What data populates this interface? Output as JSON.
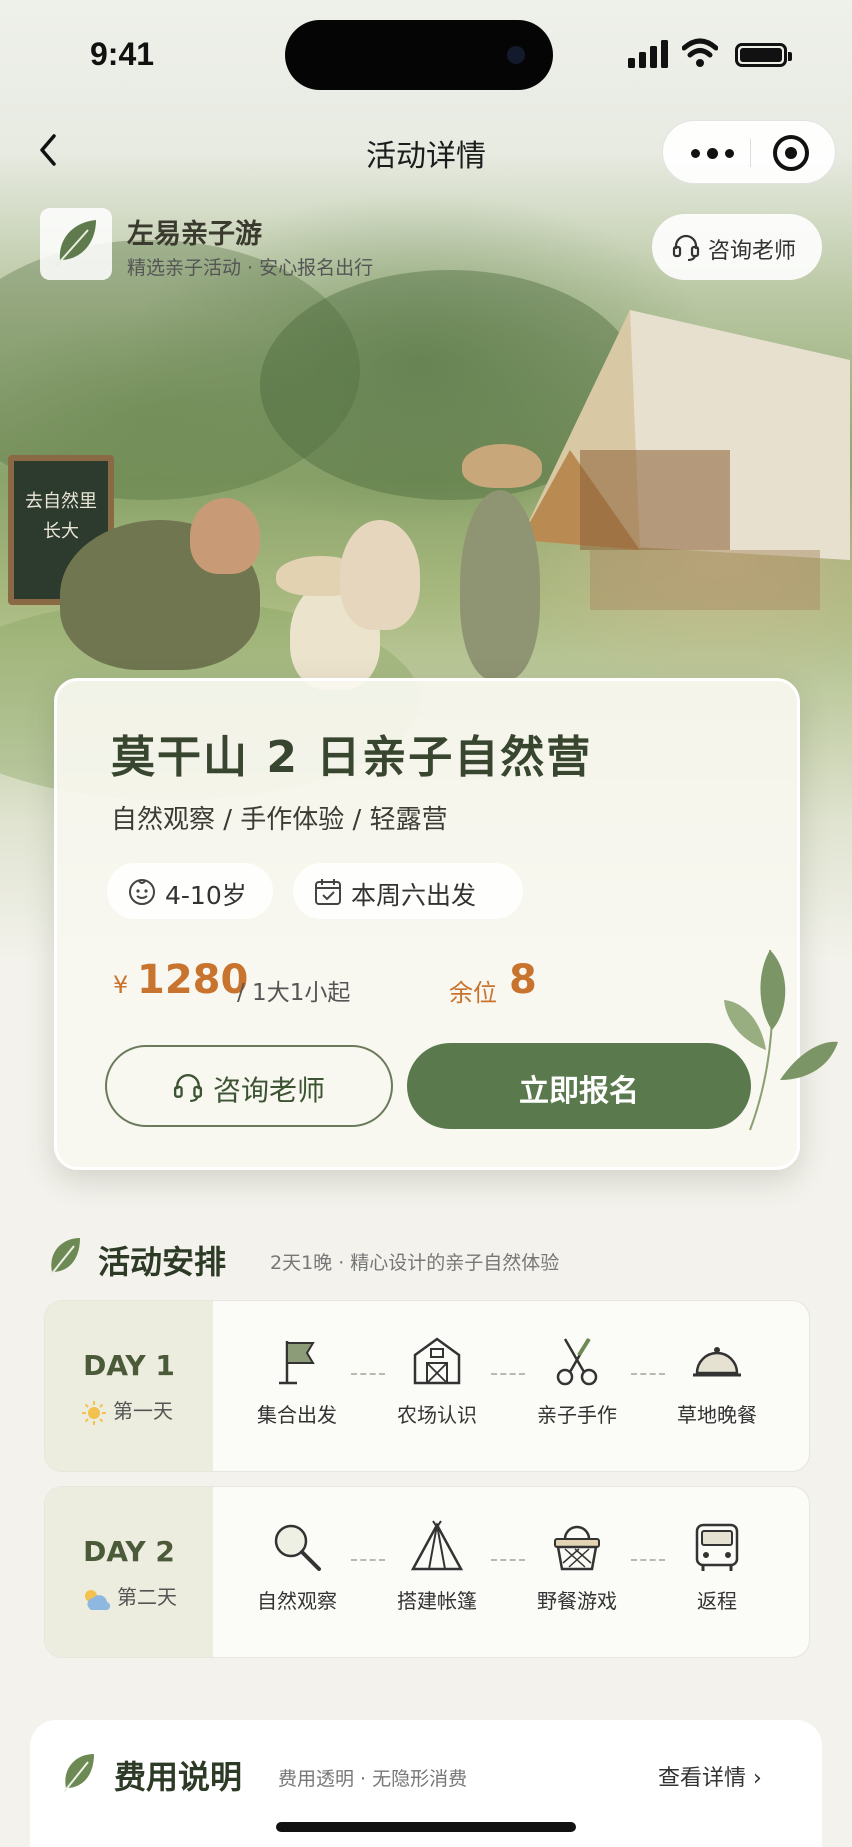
{
  "status_bar": {
    "time": "9:41"
  },
  "nav": {
    "title": "活动详情"
  },
  "brand": {
    "name": "左易亲子游",
    "tagline": "精选亲子活动 · 安心报名出行",
    "consult_label": "咨询老师"
  },
  "hero": {
    "board_line1": "去自然里",
    "board_line2": "长大"
  },
  "card": {
    "title": "莫干山 2 日亲子自然营",
    "subtitle": "自然观察 / 手作体验 / 轻露营",
    "age_chip": "4-10岁",
    "date_chip": "本周六出发",
    "currency": "¥",
    "price": "1280",
    "price_unit": "/ 1大1小起",
    "seats_label": "余位",
    "seats_count": "8",
    "consult_button": "咨询老师",
    "enroll_button": "立即报名"
  },
  "schedule": {
    "title": "活动安排",
    "subtitle": "2天1晚 · 精心设计的亲子自然体验",
    "days": [
      {
        "label": "DAY 1",
        "tag": "第一天",
        "weather_icon": "sun-icon",
        "steps": [
          {
            "label": "集合出发",
            "icon": "flag-icon"
          },
          {
            "label": "农场认识",
            "icon": "barn-icon"
          },
          {
            "label": "亲子手作",
            "icon": "scissors-icon"
          },
          {
            "label": "草地晚餐",
            "icon": "cloche-icon"
          }
        ]
      },
      {
        "label": "DAY 2",
        "tag": "第二天",
        "weather_icon": "cloud-sun-icon",
        "steps": [
          {
            "label": "自然观察",
            "icon": "magnifier-icon"
          },
          {
            "label": "搭建帐篷",
            "icon": "tent-icon"
          },
          {
            "label": "野餐游戏",
            "icon": "basket-icon"
          },
          {
            "label": "返程",
            "icon": "bus-icon"
          }
        ]
      }
    ]
  },
  "fees": {
    "title": "费用说明",
    "subtitle": "费用透明 · 无隐形消费",
    "more_label": "查看详情 ›"
  },
  "colors": {
    "primary_green": "#5a7a4e",
    "accent_orange": "#c8732e",
    "background": "#f3f2ec"
  }
}
